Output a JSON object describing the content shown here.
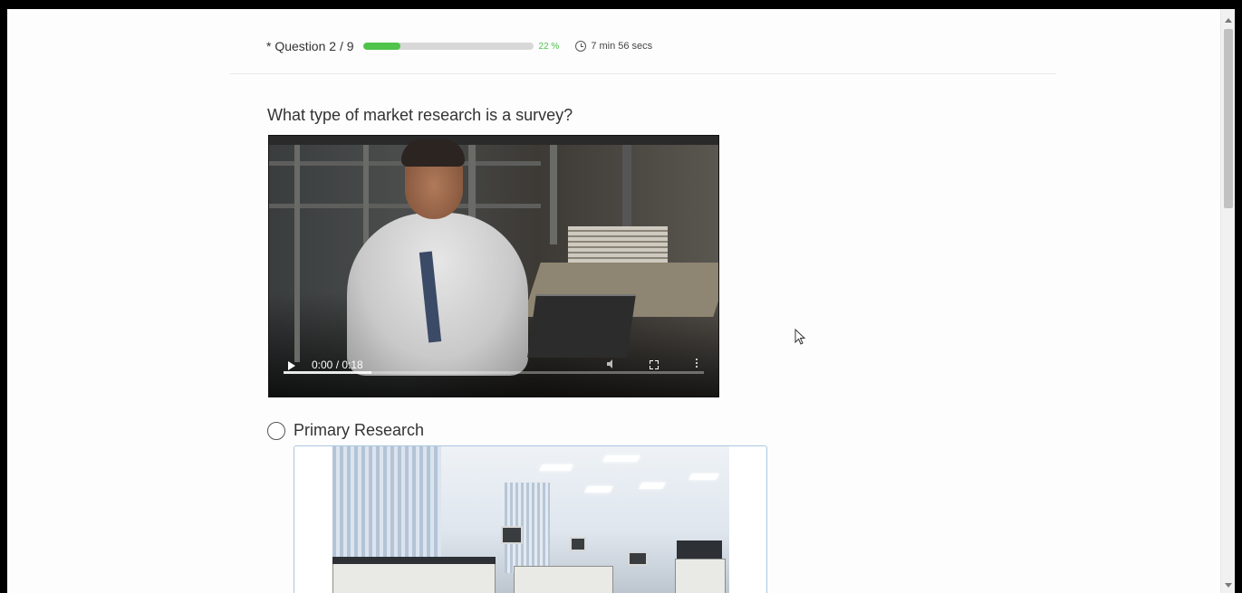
{
  "progress": {
    "question_label": "* Question 2 / 9",
    "percent_value": 22,
    "percent_label": "22 %",
    "timer_label": "7 min 56 secs"
  },
  "question": {
    "text": "What type of market research is a survey?"
  },
  "video": {
    "time_label": "0:00 / 0:18",
    "played_fraction": 0.21
  },
  "options": [
    {
      "label": "Primary Research",
      "selected": false
    }
  ],
  "icons": {
    "clock": "clock-icon",
    "play": "play-icon",
    "volume": "volume-icon",
    "fullscreen": "fullscreen-icon",
    "more": "more-options-icon",
    "cursor": "mouse-cursor-icon"
  },
  "colors": {
    "progress_fill": "#4fc34a",
    "option_border": "#aac6e0"
  }
}
